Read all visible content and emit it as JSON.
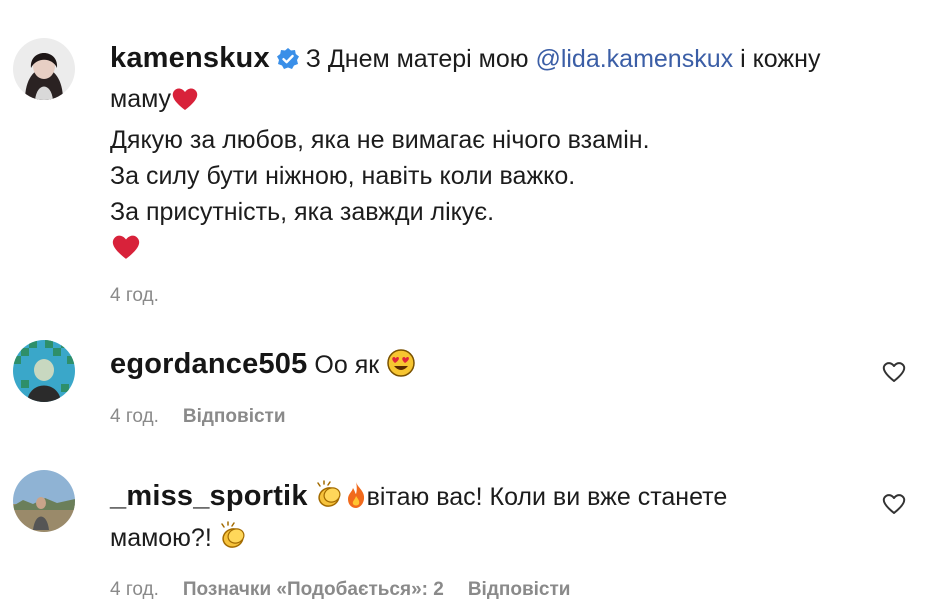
{
  "comments": [
    {
      "username": "kamenskux",
      "verified": true,
      "text_part1": "З Днем матері мою",
      "mention": "@lida.kamenskux",
      "text_part2": "і кожну",
      "line2": "маму",
      "line3": "Дякую за любов, яка не вимагає нічого взамін.",
      "line4": "За силу бути ніжною, навіть коли важко.",
      "line5": "За присутність, яка завжди лікує.",
      "time": "4 год."
    },
    {
      "username": "egordance505",
      "text": "Оо як",
      "time": "4 год.",
      "reply_label": "Відповісти"
    },
    {
      "username": "_miss_sportik",
      "text_line1": "вітаю вас! Коли ви вже станете",
      "text_line2": "мамою?!",
      "time": "4 год.",
      "likes_label": "Позначки «Подобається»: 2",
      "reply_label": "Відповісти"
    }
  ],
  "icons": {
    "verified": "verified-badge-icon",
    "heart": "red-heart-emoji",
    "heart_eyes": "heart-eyes-emoji",
    "clap": "clapping-hands-emoji",
    "fire": "fire-emoji",
    "like": "heart-outline-icon"
  },
  "colors": {
    "mention": "#3b5ea6",
    "verified": "#3a8fe8",
    "meta": "#8a8a8a",
    "heart": "#d8223a"
  }
}
